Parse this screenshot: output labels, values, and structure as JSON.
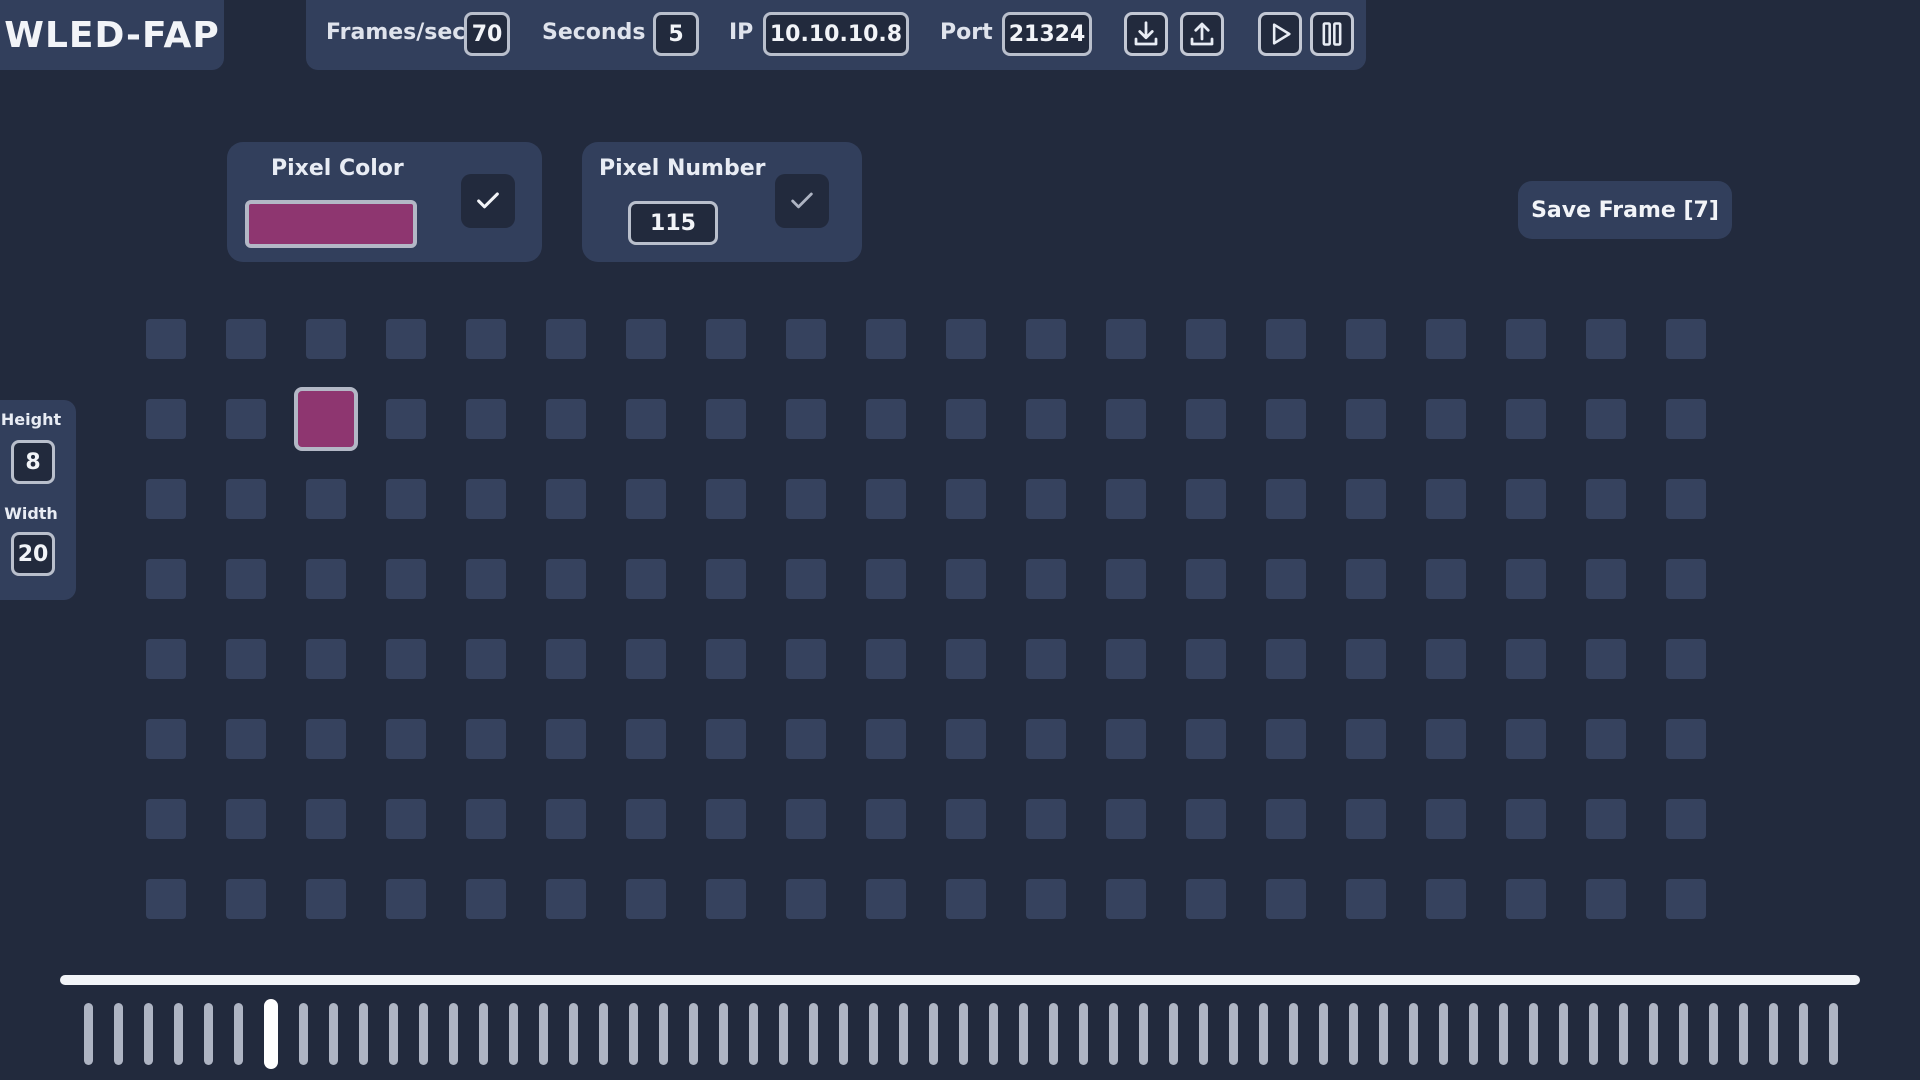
{
  "app": {
    "title": "WLED-FAP"
  },
  "topbar": {
    "fps_label": "Frames/sec",
    "fps_value": "70",
    "seconds_label": "Seconds",
    "seconds_value": "5",
    "ip_label": "IP",
    "ip_value": "10.10.10.8",
    "port_label": "Port",
    "port_value": "21324"
  },
  "icons": {
    "download": "download-icon",
    "upload": "upload-icon",
    "play": "play-icon",
    "pause": "pause-icon",
    "check": "checkmark-icon"
  },
  "pixel_color": {
    "label": "Pixel Color",
    "value": "#8e3670"
  },
  "pixel_number": {
    "label": "Pixel Number",
    "value": "115"
  },
  "save_frame": {
    "label": "Save Frame [7]"
  },
  "dimensions": {
    "height_label": "Height",
    "height_value": "8",
    "width_label": "Width",
    "width_value": "20"
  },
  "grid": {
    "rows": 8,
    "cols": 20,
    "active_row": 1,
    "active_col": 2
  },
  "timeline": {
    "frame_count": 59,
    "current_frame": 6
  },
  "colors": {
    "background": "#222a3d",
    "panel": "#323f5c",
    "cell": "#36425e",
    "accent": "#8e3670"
  }
}
